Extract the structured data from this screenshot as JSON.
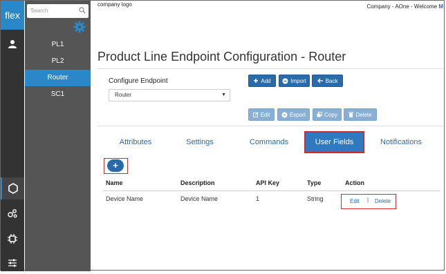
{
  "rail": {
    "logo_text": "flex",
    "icons": [
      "user-icon",
      "hexagon-icon",
      "nodes-icon",
      "chip-icon",
      "sliders-icon"
    ]
  },
  "sidebar": {
    "search_placeholder": "Search",
    "items": [
      {
        "label": "PL1",
        "active": false
      },
      {
        "label": "PL2",
        "active": false
      },
      {
        "label": "Router",
        "active": true
      },
      {
        "label": "SC1",
        "active": false
      }
    ]
  },
  "header": {
    "brand": "company logo",
    "welcome_prefix": "Company - AOne - Welcome ",
    "welcome_user": "M"
  },
  "page": {
    "title": "Product Line Endpoint Configuration - Router",
    "configure_label": "Configure Endpoint",
    "endpoint_value": "Router"
  },
  "toolbar": {
    "add": "Add",
    "import": "Import",
    "back": "Back",
    "edit": "Edit",
    "export": "Export",
    "copy": "Copy",
    "delete": "Delete"
  },
  "tabs": [
    {
      "label": "Attributes",
      "active": false
    },
    {
      "label": "Settings",
      "active": false
    },
    {
      "label": "Commands",
      "active": false
    },
    {
      "label": "User Fields",
      "active": true
    },
    {
      "label": "Notifications",
      "active": false
    }
  ],
  "add_symbol": "+",
  "table": {
    "headers": [
      "Name",
      "Description",
      "API Key",
      "Type",
      "Action"
    ],
    "rows": [
      {
        "name": "Device Name",
        "description": "Device Name",
        "api_key": "1",
        "type": "String",
        "edit": "Edit",
        "separator": "|",
        "delete": "Delete"
      }
    ]
  },
  "colors": {
    "accent": "#2a6aa8",
    "highlight": "#d42a2a",
    "rail": "#333333",
    "sidebar": "#555555"
  }
}
